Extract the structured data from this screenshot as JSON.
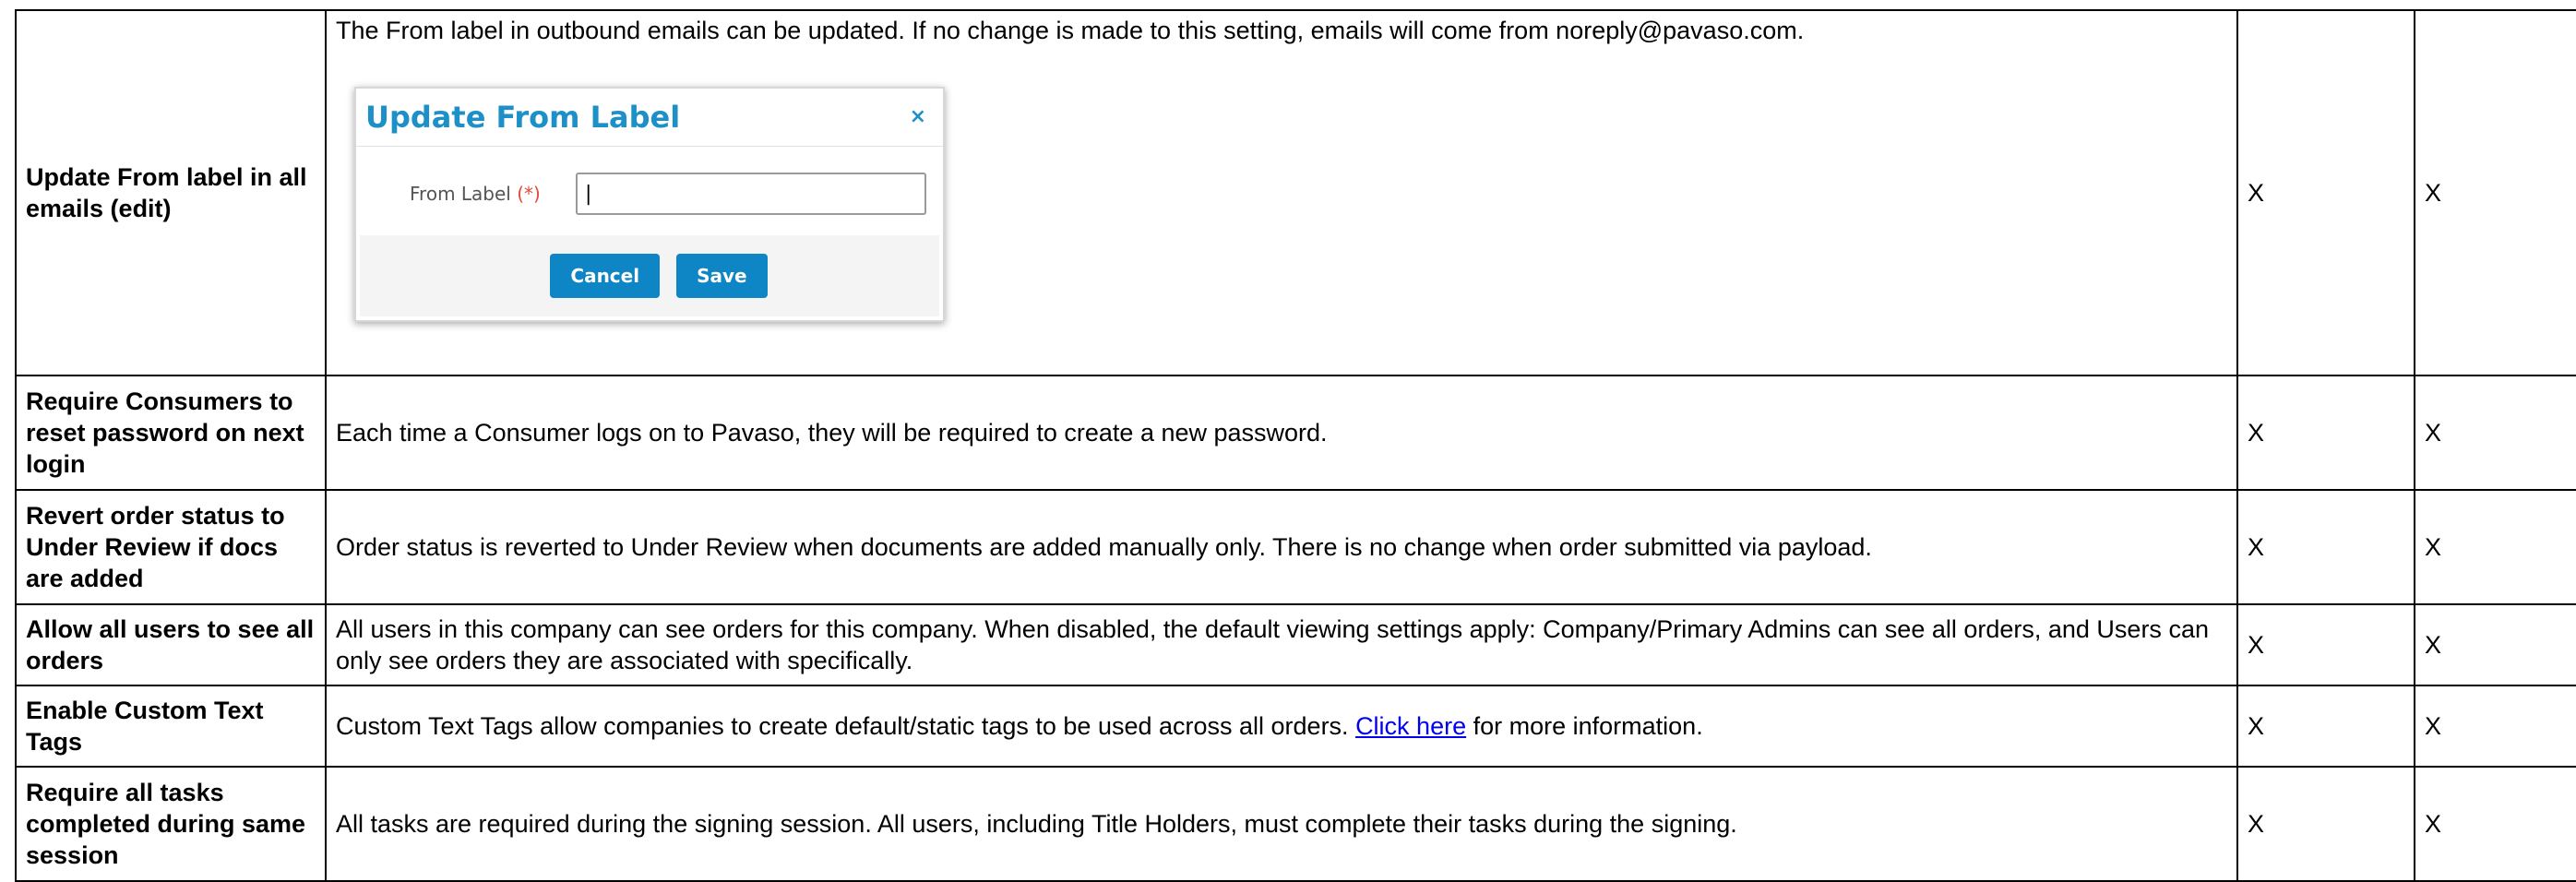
{
  "rows": [
    {
      "name": "Update From label in all emails (edit)",
      "description": "The From label in outbound emails can be updated. If no change is made to this setting, emails will come from noreply@pavaso.com.",
      "col3": "X",
      "col4": "X"
    },
    {
      "name": "Require Consumers to reset password on next login",
      "description": "Each time a Consumer logs on to Pavaso, they will be required to create a new password.",
      "col3": "X",
      "col4": "X"
    },
    {
      "name": "Revert order status to Under Review if docs are added",
      "description": "Order status is reverted to Under Review when documents are added manually only. There is no change when order submitted via payload.",
      "col3": "X",
      "col4": "X"
    },
    {
      "name": "Allow all users to see all orders",
      "description": "All users in this company can see orders for this company. When disabled, the default viewing settings apply: Company/Primary Admins can see all orders, and Users can only see orders they are associated with specifically.",
      "col3": "X",
      "col4": "X"
    },
    {
      "name": "Enable Custom Text Tags",
      "description_pre": "Custom Text Tags allow companies to create default/static tags to be used across all orders. ",
      "link_text": "Click here",
      "description_post": " for more information.",
      "col3": "X",
      "col4": "X"
    },
    {
      "name": "Require all tasks completed during same session",
      "description": "All tasks are required during the signing session. All users, including Title Holders, must complete their tasks during the signing.",
      "col3": "X",
      "col4": "X"
    }
  ],
  "dialog": {
    "title": "Update From Label",
    "close_glyph": "×",
    "field_label": "From Label",
    "required_marker": "(*)",
    "field_value": "|",
    "cancel_label": "Cancel",
    "save_label": "Save",
    "accent_color": "#1d90c8",
    "button_color": "#0e85c4"
  }
}
